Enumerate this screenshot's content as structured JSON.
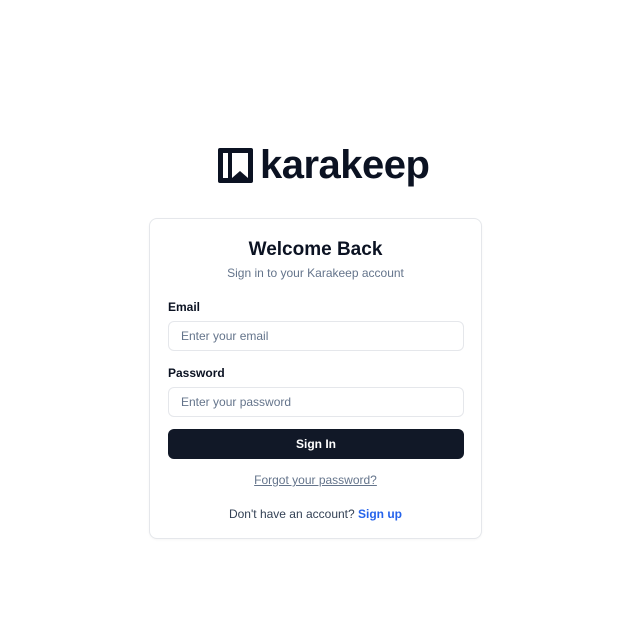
{
  "brand": {
    "name": "karakeep",
    "icon": "karakeep-logo-icon",
    "color": "#0b1222"
  },
  "card": {
    "title": "Welcome Back",
    "subtitle": "Sign in to your Karakeep account"
  },
  "form": {
    "email_label": "Email",
    "email_placeholder": "Enter your email",
    "email_value": "",
    "password_label": "Password",
    "password_placeholder": "Enter your password",
    "password_value": "",
    "submit_label": "Sign In",
    "submit_color": "#111827"
  },
  "links": {
    "forgot_password": "Forgot your password?",
    "no_account_prompt": "Don't have an account?",
    "sign_up": "Sign up",
    "sign_up_color": "#2563eb"
  }
}
